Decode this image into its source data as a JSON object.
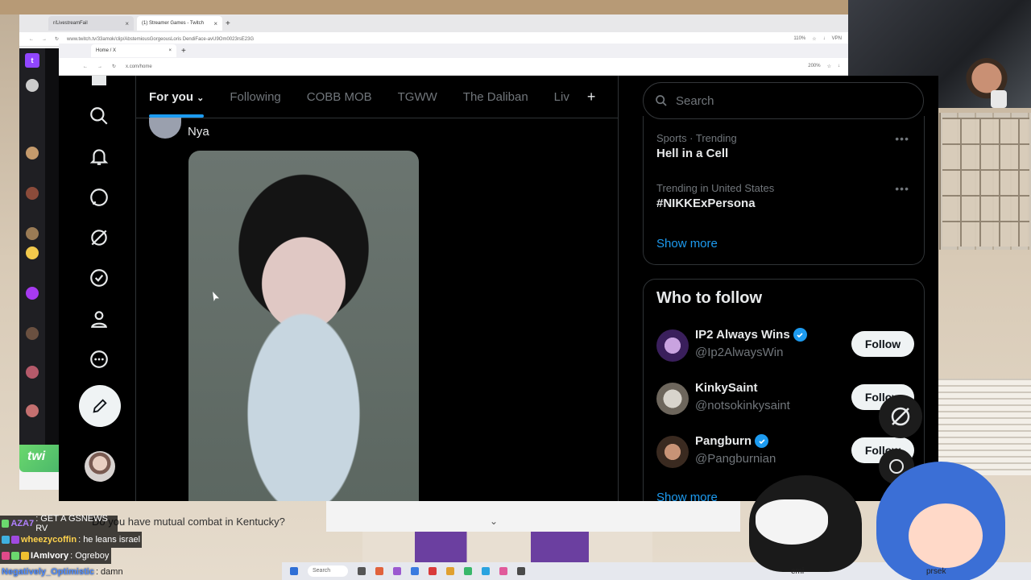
{
  "outer_browser": {
    "tabs": [
      {
        "label": "r/LivestreamFail"
      },
      {
        "label": "(1) Streamer Games - Twitch"
      }
    ],
    "url": "www.twitch.tv/33amok/clip/AbstemiousGorgeousLoris DendiFace-avU9Om0023rsE23G",
    "zoom": "110%",
    "vpn": "VPN"
  },
  "inner_browser": {
    "tab_label": "Home / X",
    "url": "x.com/home",
    "zoom": "200%"
  },
  "x": {
    "tabs": [
      "For you",
      "Following",
      "COBB MOB",
      "TGWW",
      "The Daliban",
      "Liv"
    ],
    "post": {
      "text": "Nya"
    },
    "search_placeholder": "Search",
    "trends": [
      {
        "meta": "Sports · Trending",
        "name": "Hell in a Cell"
      },
      {
        "meta": "Trending in United States",
        "name": "#NIKKExPersona"
      }
    ],
    "show_more": "Show more",
    "who_to_follow": {
      "title": "Who to follow",
      "accounts": [
        {
          "name": "IP2 Always Wins",
          "handle": "@Ip2AlwaysWin",
          "verified": true,
          "button": "Follow"
        },
        {
          "name": "KinkySaint",
          "handle": "@notsokinkysaint",
          "verified": false,
          "button": "Follow"
        },
        {
          "name": "Pangburn",
          "handle": "@Pangburnian",
          "verified": true,
          "button": "Follow"
        }
      ],
      "show_more": "Show more"
    }
  },
  "chat": {
    "top_message": "Do you have mutual combat in Kentucky?",
    "lines": [
      {
        "user": "AZA7",
        "message": ": GET A GSNEWS RV",
        "color": "#b080ff"
      },
      {
        "user": "wheezycoffin",
        "message": ": he leans israel",
        "color": "#ffd34d"
      },
      {
        "user": "IAmIvory",
        "message": ": Ogreboy",
        "color": "#ffffff"
      },
      {
        "user": "Negatively_Optimistic",
        "message": ": damn",
        "color": "#4f8cff"
      }
    ]
  },
  "taskbar": {
    "search": "Search"
  },
  "overlay_labels": {
    "left_char": "emi",
    "right_char": "prsek"
  },
  "colors": {
    "accent": "#1d9bf0",
    "x_bg": "#000000",
    "twitch": "#9146ff"
  }
}
